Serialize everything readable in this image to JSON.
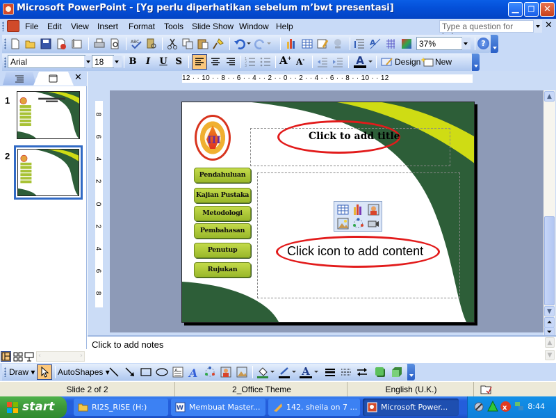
{
  "window": {
    "title": "Microsoft PowerPoint - [Yg perlu diperhatikan sebelum m’bwt presentasi]",
    "controls": [
      "minimize",
      "restore",
      "close"
    ]
  },
  "menubar": {
    "items": [
      "File",
      "Edit",
      "View",
      "Insert",
      "Format",
      "Tools",
      "Slide Show",
      "Window",
      "Help"
    ],
    "help_placeholder": "Type a question for help"
  },
  "standard_toolbar": {
    "icons": [
      "new-icon",
      "open-icon",
      "save-icon",
      "permission-icon",
      "email-icon",
      "print-icon",
      "print-preview-icon",
      "spelling-icon",
      "research-icon",
      "cut-icon",
      "copy-icon",
      "paste-icon",
      "format-painter-icon",
      "undo-icon",
      "redo-icon",
      "insert-chart-icon",
      "insert-table-icon",
      "tables-borders-icon",
      "hyperlink-icon",
      "expand-all-icon",
      "show-formatting-icon",
      "grid-icon",
      "color-grayscale-icon"
    ],
    "zoom": "37%"
  },
  "formatting_toolbar": {
    "font": "Arial",
    "size": "18",
    "bold": "B",
    "italic": "I",
    "underline": "U",
    "shadow": "S",
    "design_label": "Design",
    "new_slide_label": "New Slide",
    "font_color": "#000000"
  },
  "left_pane": {
    "tabs": [
      "Outline",
      "Slides"
    ],
    "slides": [
      {
        "number": "1",
        "selected": false
      },
      {
        "number": "2",
        "selected": true
      }
    ]
  },
  "rulers": {
    "horizontal": "12 · · 10 · · 8 · · 6 · · 4 · · 2 · · 0 · · 2 · · 4 · · 6 · · 8 · · 10 · · 12",
    "vertical": [
      "8",
      "6",
      "4",
      "2",
      "0",
      "2",
      "4",
      "6",
      "8"
    ]
  },
  "slide": {
    "title_placeholder": "Click to add title",
    "content_placeholder": "Click icon to add content",
    "nav_buttons": [
      "Pendahuluan",
      "Kajian Pustaka",
      "Metodologi",
      "Pembahasan",
      "Penutup",
      "Rujukan"
    ],
    "content_icons": [
      "insert-table-icon",
      "insert-chart-icon",
      "insert-clipart-icon",
      "insert-picture-icon",
      "insert-diagram-icon",
      "insert-media-icon"
    ],
    "colors": {
      "dark_green": "#2d5e38",
      "yellow_green": "#cfdc14",
      "button_green": "#a8c235",
      "highlight_red": "#e21b1b"
    }
  },
  "notes": {
    "placeholder": "Click to add notes"
  },
  "draw_toolbar": {
    "draw_label": "Draw",
    "autoshapes_label": "AutoShapes",
    "icons": [
      "select-icon",
      "line-icon",
      "arrow-icon",
      "rectangle-icon",
      "oval-icon",
      "textbox-icon",
      "wordart-icon",
      "diagram-icon",
      "clipart-icon",
      "picture-icon",
      "fill-color-icon",
      "line-color-icon",
      "font-color-icon",
      "line-style-icon",
      "dash-style-icon",
      "arrow-style-icon",
      "shadow-icon",
      "3d-icon"
    ]
  },
  "statusbar": {
    "slide_info": "Slide 2 of 2",
    "theme": "2_Office Theme",
    "language": "English (U.K.)"
  },
  "taskbar": {
    "start_label": "start",
    "tasks": [
      {
        "label": "RI2S_RISE (H:)",
        "active": false
      },
      {
        "label": "Membuat Master...",
        "active": false
      },
      {
        "label": "142. sheila on 7 ...",
        "active": false
      },
      {
        "label": "Microsoft Power...",
        "active": true
      }
    ],
    "clock": "8:44"
  }
}
